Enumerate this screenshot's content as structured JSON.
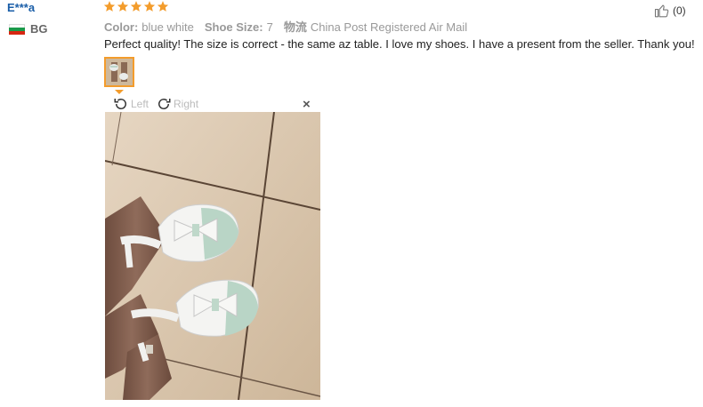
{
  "reviewer": {
    "name": "E***a",
    "country_code": "BG"
  },
  "rating": {
    "stars": 5,
    "max": 5
  },
  "meta": {
    "color_label": "Color:",
    "color_value": "blue white",
    "size_label": "Shoe Size:",
    "size_value": "7",
    "shipping_label": "物流",
    "shipping_value": "China Post Registered Air Mail"
  },
  "like": {
    "icon": "thumbs-up-icon",
    "count": "(0)"
  },
  "review_text": "Perfect quality! The size is correct - the same az table. I love my shoes. I have a present from the seller. Thank you!",
  "viewer": {
    "rotate_left_label": "Left",
    "rotate_right_label": "Right",
    "close_label": "×"
  },
  "colors": {
    "accent": "#f39c2c",
    "username": "#1a5ea8",
    "star": "#f39c2c"
  }
}
